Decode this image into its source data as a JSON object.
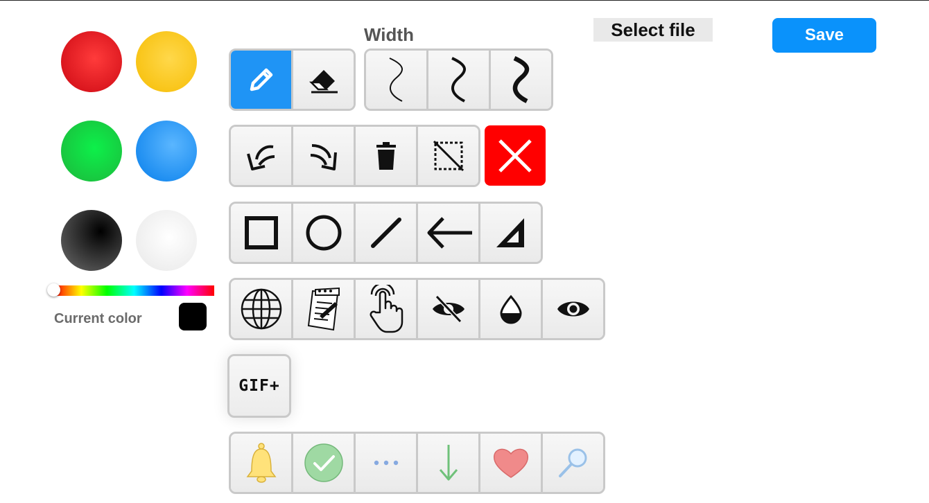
{
  "header": {
    "width_label": "Width",
    "select_file_label": "Select file",
    "save_label": "Save"
  },
  "palette": {
    "colors": [
      "#e3161f",
      "#fbc824",
      "#16d845",
      "#2a9ef8",
      "#000000",
      "#f3f3f3"
    ],
    "current_color_label": "Current color",
    "current_color": "#000000",
    "hue_value": 0
  },
  "toolbar": {
    "tools": [
      "pencil-icon",
      "eraser-icon"
    ],
    "widths": [
      "thin-width-icon",
      "medium-width-icon",
      "thick-width-icon"
    ],
    "edit": [
      "undo-icon",
      "redo-icon",
      "trash-icon",
      "clear-selection-icon",
      "close-icon"
    ],
    "shapes": [
      "square-icon",
      "circle-icon",
      "line-icon",
      "arrow-left-icon",
      "triangle-ruler-icon"
    ],
    "misc": [
      "globe-icon",
      "notepad-icon",
      "touch-icon",
      "eye-off-icon",
      "drop-icon",
      "eye-icon"
    ],
    "gif_label": "GIF+",
    "emoji": [
      "bell-icon",
      "check-circle-icon",
      "ellipsis-icon",
      "arrow-down-icon",
      "heart-icon",
      "magnifier-icon"
    ]
  }
}
